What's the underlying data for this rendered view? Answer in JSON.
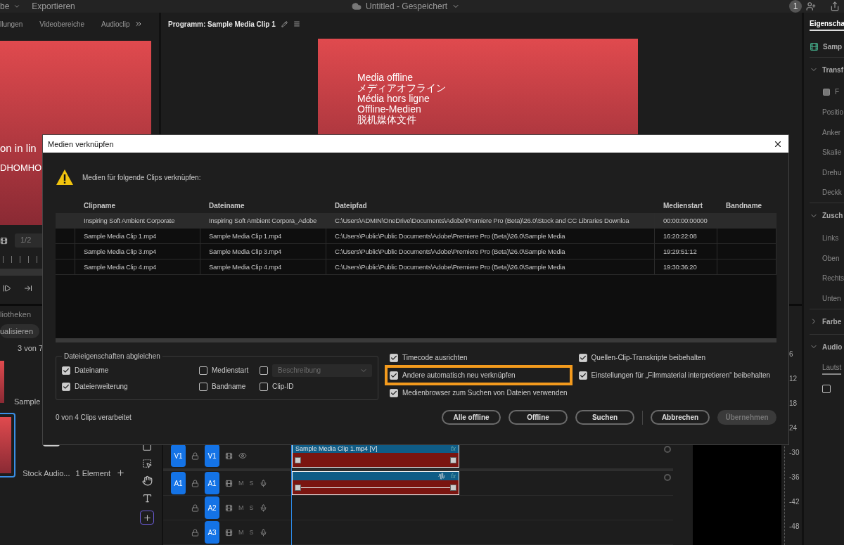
{
  "top_bar": {
    "menus": [
      "be",
      "Exportieren"
    ],
    "title": "Untitled - Gespeichert",
    "badge": "1"
  },
  "source_panel": {
    "tabs": [
      {
        "label": "llungen",
        "selected": false
      },
      {
        "label": "Videobereiche",
        "selected": false
      },
      {
        "label": "Audioclip",
        "selected": false
      }
    ],
    "slate_lines": [
      "on in lin",
      "DHOMHO"
    ],
    "zoom_field": "1/2"
  },
  "program_panel": {
    "title": "Programm: Sample Media Clip 1",
    "slate_lines": [
      "Media offline",
      "メディアオフライン",
      "Média hors ligne",
      "Offline-Medien",
      "脱机媒体文件"
    ]
  },
  "project_panel": {
    "tab": "liotheken",
    "button": "ualisieren",
    "count": "3 von 7",
    "items": [
      {
        "name": "Sample",
        "selected": false
      },
      {
        "name": "Stock Audio...",
        "count": "1 Element",
        "selected": true
      }
    ]
  },
  "timeline": {
    "tracks": [
      {
        "kind": "video",
        "target": "V1",
        "name": "V1"
      },
      {
        "kind": "audio",
        "target": "A1",
        "name": "A1",
        "mute": "M",
        "solo": "S"
      },
      {
        "kind": "audio",
        "name": "A2",
        "mute": "M",
        "solo": "S"
      },
      {
        "kind": "audio",
        "name": "A3",
        "mute": "M",
        "solo": "S"
      }
    ],
    "clips": [
      {
        "kind": "video",
        "label": "Sample Media Clip 1.mp4 [V]",
        "fx": "fx"
      },
      {
        "kind": "audio",
        "fx": "fx"
      }
    ]
  },
  "meter": {
    "scale": [
      "6",
      "12",
      "18",
      "24",
      "-30",
      "-36",
      "-42",
      "-48"
    ]
  },
  "properties": {
    "tab": "Eigenscha",
    "clip": "Samp",
    "sections": [
      {
        "title": "Transf",
        "expanded": true,
        "items": [
          {
            "kind": "icon_row",
            "label": "F"
          },
          {
            "kind": "row",
            "label": "Positio"
          },
          {
            "kind": "row",
            "label": "Anker"
          },
          {
            "kind": "row",
            "label": "Skalie"
          },
          {
            "kind": "row",
            "label": "Drehu"
          },
          {
            "kind": "row",
            "label": "Deckk"
          }
        ]
      },
      {
        "title": "Zusch",
        "expanded": true,
        "items": [
          {
            "kind": "row",
            "label": "Links"
          },
          {
            "kind": "row",
            "label": "Oben"
          },
          {
            "kind": "row",
            "label": "Rechts"
          },
          {
            "kind": "row",
            "label": "Unten"
          }
        ]
      },
      {
        "title": "Farbe",
        "expanded": false
      },
      {
        "title": "Audio",
        "expanded": true,
        "items": [
          {
            "kind": "tab",
            "label": "Lautst"
          },
          {
            "kind": "checkbox",
            "checked": false
          }
        ]
      }
    ]
  },
  "dialog": {
    "title": "Medien verknüpfen",
    "message": "Medien für folgende Clips verknüpfen:",
    "columns": [
      "Clipname",
      "Dateiname",
      "Dateipfad",
      "Medienstart",
      "Bandname"
    ],
    "rows": [
      {
        "selected": true,
        "clipname": "Inspiring Soft Ambient Corporate",
        "dateiname": "Inspiring Soft Ambient Corpora_Adobe",
        "dateipfad": "C:\\Users\\ADMIN\\OneDrive\\Documents\\Adobe\\Premiere Pro (Beta)\\26.0\\Stock and CC Libraries Downloa",
        "medienstart": "00:00:00:00000"
      },
      {
        "selected": false,
        "clipname": "Sample Media Clip 1.mp4",
        "dateiname": "Sample Media Clip 1.mp4",
        "dateipfad": "C:\\Users\\Public\\Public Documents\\Adobe\\Premiere Pro (Beta)\\26.0\\Sample Media",
        "medienstart": "16:20:22:08"
      },
      {
        "selected": false,
        "clipname": "Sample Media Clip 3.mp4",
        "dateiname": "Sample Media Clip 3.mp4",
        "dateipfad": "C:\\Users\\Public\\Public Documents\\Adobe\\Premiere Pro (Beta)\\26.0\\Sample Media",
        "medienstart": "19:29:51:12"
      },
      {
        "selected": false,
        "clipname": "Sample Media Clip 4.mp4",
        "dateiname": "Sample Media Clip 4.mp4",
        "dateipfad": "C:\\Users\\Public\\Public Documents\\Adobe\\Premiere Pro (Beta)\\26.0\\Sample Media",
        "medienstart": "19:30:36:20"
      }
    ],
    "match_group": {
      "title": "Dateieigenschaften abgleichen",
      "options": [
        {
          "kind": "checkbox",
          "label": "Dateiname",
          "checked": true
        },
        {
          "kind": "checkbox",
          "label": "Medienstart",
          "checked": false
        },
        {
          "kind": "dropdown",
          "label": "Beschreibung",
          "checked": false,
          "disabled": true
        },
        {
          "kind": "checkbox",
          "label": "Dateierweiterung",
          "checked": true
        },
        {
          "kind": "checkbox",
          "label": "Bandname",
          "checked": false
        },
        {
          "kind": "checkbox",
          "label": "Clip-ID",
          "checked": false
        }
      ]
    },
    "options": [
      {
        "label": "Timecode ausrichten",
        "checked": true,
        "highlighted": false
      },
      {
        "label": "Andere automatisch neu verknüpfen",
        "checked": true,
        "highlighted": true
      },
      {
        "label": "Medienbrowser zum Suchen von Dateien verwenden",
        "checked": true,
        "highlighted": false
      }
    ],
    "keep_options": [
      {
        "label": "Quellen-Clip-Transkripte beibehalten",
        "checked": true
      },
      {
        "label": "Einstellungen für „Filmmaterial interpretieren“ beibehalten",
        "checked": true
      }
    ],
    "status": "0 von 4 Clips verarbeitet",
    "search_buttons": [
      {
        "label": "Alle offline",
        "disabled": false
      },
      {
        "label": "Offline",
        "disabled": false
      },
      {
        "label": "Suchen",
        "disabled": false
      }
    ],
    "confirm_buttons": [
      {
        "label": "Abbrechen",
        "disabled": false
      },
      {
        "label": "Übernehmen",
        "disabled": true
      }
    ]
  }
}
